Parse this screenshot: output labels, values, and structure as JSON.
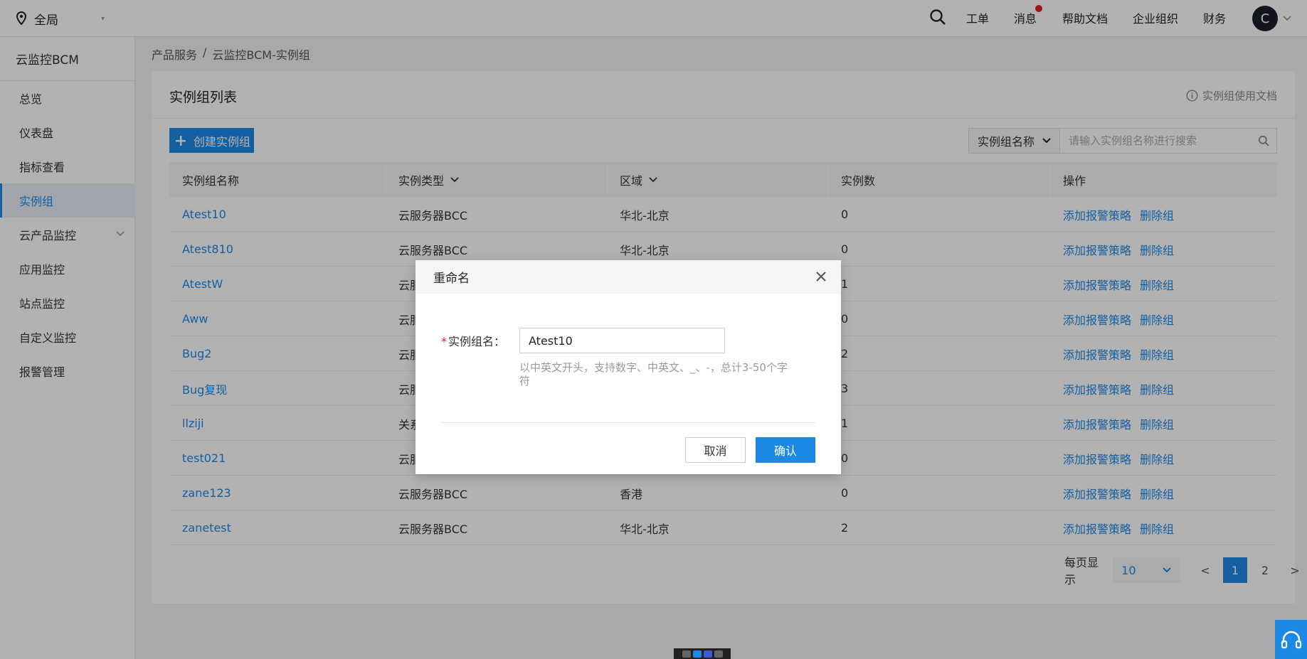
{
  "topbar": {
    "region": "全局",
    "nav": [
      "工单",
      "消息",
      "帮助文档",
      "企业组织",
      "财务"
    ],
    "avatar_letter": "C"
  },
  "sidebar": {
    "product": "云监控BCM",
    "items": [
      {
        "label": "总览"
      },
      {
        "label": "仪表盘"
      },
      {
        "label": "指标查看"
      },
      {
        "label": "实例组",
        "active": true
      },
      {
        "label": "云产品监控",
        "expandable": true
      },
      {
        "label": "应用监控"
      },
      {
        "label": "站点监控"
      },
      {
        "label": "自定义监控"
      },
      {
        "label": "报警管理"
      }
    ]
  },
  "breadcrumb": {
    "root": "产品服务",
    "separator": "/",
    "current": "云监控BCM-实例组"
  },
  "main": {
    "title": "实例组列表",
    "doc_link": "实例组使用文档",
    "create_button": "创建实例组",
    "search": {
      "field": "实例组名称",
      "placeholder": "请输入实例组名称进行搜索"
    }
  },
  "table": {
    "headers": [
      "实例组名称",
      "实例类型",
      "区域",
      "实例数",
      "操作"
    ],
    "rows": [
      {
        "name": "Atest10",
        "type": "云服务器BCC",
        "region": "华北-北京",
        "count": "0"
      },
      {
        "name": "Atest810",
        "type": "云服务器BCC",
        "region": "华北-北京",
        "count": "0"
      },
      {
        "name": "AtestW",
        "type": "云服",
        "region": "",
        "count": "1"
      },
      {
        "name": "Aww",
        "type": "云服",
        "region": "",
        "count": "0"
      },
      {
        "name": "Bug2",
        "type": "云服",
        "region": "",
        "count": "2"
      },
      {
        "name": "Bug复现",
        "type": "云服",
        "region": "",
        "count": "3"
      },
      {
        "name": "llziji",
        "type": "关系",
        "region": "",
        "count": "1"
      },
      {
        "name": "test021",
        "type": "云服",
        "region": "",
        "count": "0"
      },
      {
        "name": "zane123",
        "type": "云服务器BCC",
        "region": "香港",
        "count": "0"
      },
      {
        "name": "zanetest",
        "type": "云服务器BCC",
        "region": "华北-北京",
        "count": "2"
      }
    ],
    "actions": {
      "add_alarm": "添加报警策略",
      "delete": "删除组"
    }
  },
  "pagination": {
    "label": "每页显示",
    "page_size": "10",
    "prev": "<",
    "pages": [
      "1",
      "2"
    ],
    "current": "1",
    "next": ">"
  },
  "dialog": {
    "title": "重命名",
    "required_mark": "*",
    "field_label": "实例组名：",
    "field_value": "Atest10",
    "hint": "以中英文开头，支持数字、中英文、_、-，总计3-50个字符",
    "cancel": "取消",
    "confirm": "确认"
  },
  "colors": {
    "primary": "#1e88e5",
    "danger": "#e02020",
    "overlay": "rgba(0,0,0,0.30)"
  }
}
